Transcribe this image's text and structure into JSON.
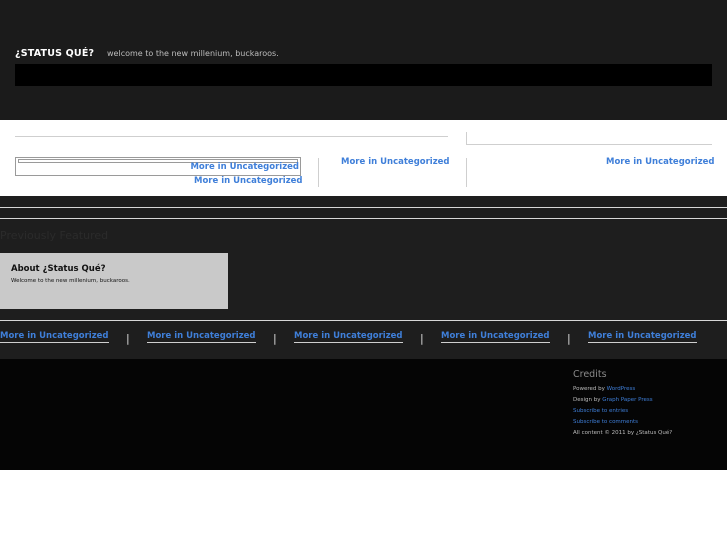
{
  "header": {
    "site_title": "¿STATUS QUÉ?",
    "site_description": "welcome to the new millenium, buckaroos."
  },
  "featured": {
    "col1_link_a": "More in Uncategorized",
    "col1_link_b": "More in Uncategorized",
    "col2_link": "More in Uncategorized",
    "col3_link": "More in Uncategorized"
  },
  "previously_featured": {
    "title": "Previously Featured",
    "about_title": "About ¿Status Qué?",
    "about_text": "Welcome to the new millenium, buckaroos."
  },
  "more_links": [
    "More in Uncategorized",
    "More in Uncategorized",
    "More in Uncategorized",
    "More in Uncategorized",
    "More in Uncategorized"
  ],
  "separator_char": "|",
  "footer": {
    "credits_title": "Credits",
    "powered_prefix": "Powered by",
    "powered_link": "WordPress",
    "design_prefix": "Design by",
    "design_link": "Graph Paper Press",
    "subscribe_entries": "Subscribe to entries",
    "subscribe_comments": "Subscribe to comments",
    "copyright": "All content © 2011 by ¿Status Qué?"
  },
  "colors": {
    "link": "#3f7fd9",
    "header_bg": "#1b1b1b",
    "footer_bg": "#050505",
    "about_bg": "#c9c9c9"
  }
}
